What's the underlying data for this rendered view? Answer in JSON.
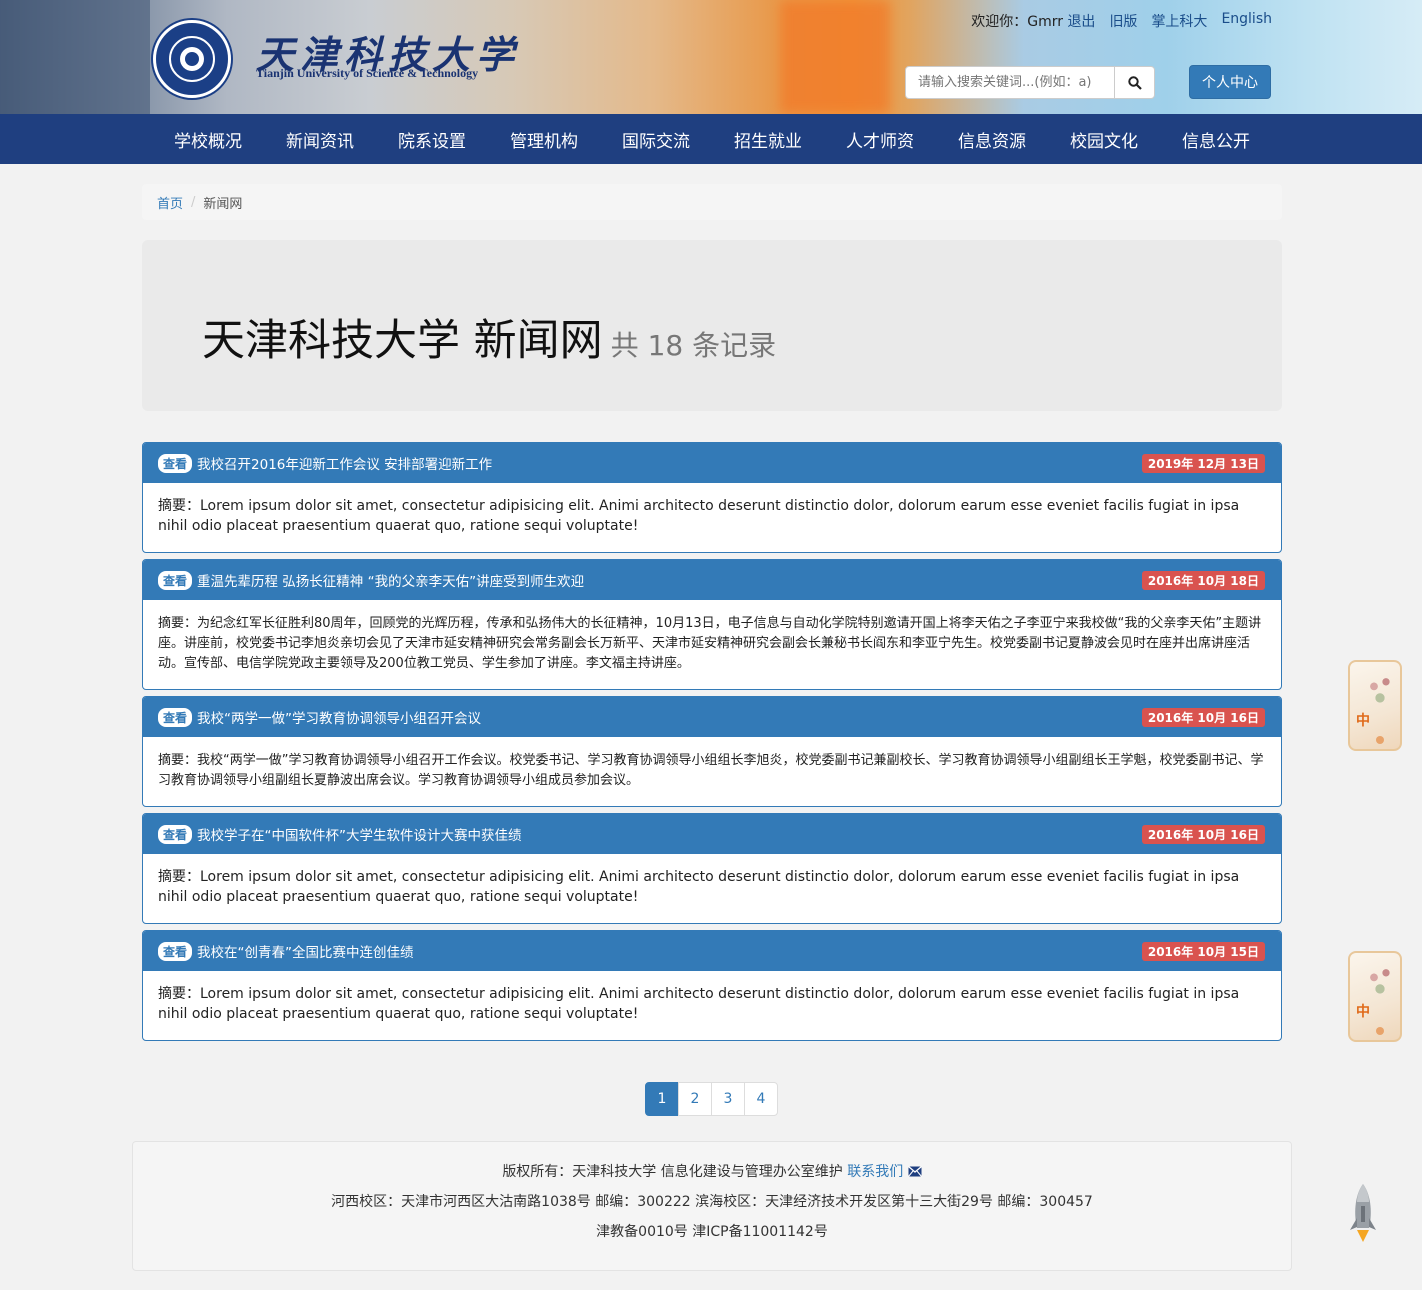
{
  "header": {
    "logo_cn": "天津科技大学",
    "logo_en": "Tianjin University of Science & Technology",
    "welcome": "欢迎你：Gmrr",
    "links": [
      "退出",
      "旧版",
      "掌上科大",
      "English"
    ],
    "search_placeholder": "请输入搜索关键词...(例如：a)",
    "personal_center": "个人中心"
  },
  "nav": [
    "学校概况",
    "新闻资讯",
    "院系设置",
    "管理机构",
    "国际交流",
    "招生就业",
    "人才师资",
    "信息资源",
    "校园文化",
    "信息公开"
  ],
  "breadcrumb": {
    "home": "首页",
    "current": "新闻网"
  },
  "jumbo": {
    "title": "天津科技大学 新闻网",
    "count": "共 18 条记录"
  },
  "view_label": "查看",
  "news": [
    {
      "title": "我校召开2016年迎新工作会议 安排部署迎新工作",
      "date": "2019年 12月 13日",
      "summary": "摘要：Lorem ipsum dolor sit amet, consectetur adipisicing elit. Animi architecto deserunt distinctio dolor, dolorum earum esse eveniet facilis fugiat in ipsa nihil odio placeat praesentium quaerat quo, ratione sequi voluptate!"
    },
    {
      "title": "重温先辈历程 弘扬长征精神 “我的父亲李天佑”讲座受到师生欢迎",
      "date": "2016年 10月 18日",
      "summary": "摘要：为纪念红军长征胜利80周年，回顾党的光辉历程，传承和弘扬伟大的长征精神，10月13日，电子信息与自动化学院特别邀请开国上将李天佑之子李亚宁来我校做“我的父亲李天佑”主题讲座。讲座前，校党委书记李旭炎亲切会见了天津市延安精神研究会常务副会长万新平、天津市延安精神研究会副会长兼秘书长阎东和李亚宁先生。校党委副书记夏静波会见时在座并出席讲座活动。宣传部、电信学院党政主要领导及200位教工党员、学生参加了讲座。李文福主持讲座。"
    },
    {
      "title": "我校“两学一做”学习教育协调领导小组召开会议",
      "date": "2016年 10月 16日",
      "summary": "摘要：我校“两学一做”学习教育协调领导小组召开工作会议。校党委书记、学习教育协调领导小组组长李旭炎，校党委副书记兼副校长、学习教育协调领导小组副组长王学魁，校党委副书记、学习教育协调领导小组副组长夏静波出席会议。学习教育协调领导小组成员参加会议。"
    },
    {
      "title": "我校学子在“中国软件杯”大学生软件设计大赛中获佳绩",
      "date": "2016年 10月 16日",
      "summary": "摘要：Lorem ipsum dolor sit amet, consectetur adipisicing elit. Animi architecto deserunt distinctio dolor, dolorum earum esse eveniet facilis fugiat in ipsa nihil odio placeat praesentium quaerat quo, ratione sequi voluptate!"
    },
    {
      "title": "我校在“创青春”全国比赛中连创佳绩",
      "date": "2016年 10月 15日",
      "summary": "摘要：Lorem ipsum dolor sit amet, consectetur adipisicing elit. Animi architecto deserunt distinctio dolor, dolorum earum esse eveniet facilis fugiat in ipsa nihil odio placeat praesentium quaerat quo, ratione sequi voluptate!"
    }
  ],
  "pagination": [
    "1",
    "2",
    "3",
    "4"
  ],
  "footer": {
    "copyright": "版权所有：天津科技大学 信息化建设与管理办公室维护",
    "contact": "联系我们",
    "address": "河西校区：天津市河西区大沽南路1038号 邮编：300222 滨海校区：天津经济技术开发区第十三大街29号 邮编：300457",
    "icp": "津教备0010号 津ICP备11001142号"
  },
  "float_card_char": "中",
  "colors": {
    "nav": "#1f3f80",
    "primary": "#337ab7",
    "date_badge": "#d9534f"
  }
}
